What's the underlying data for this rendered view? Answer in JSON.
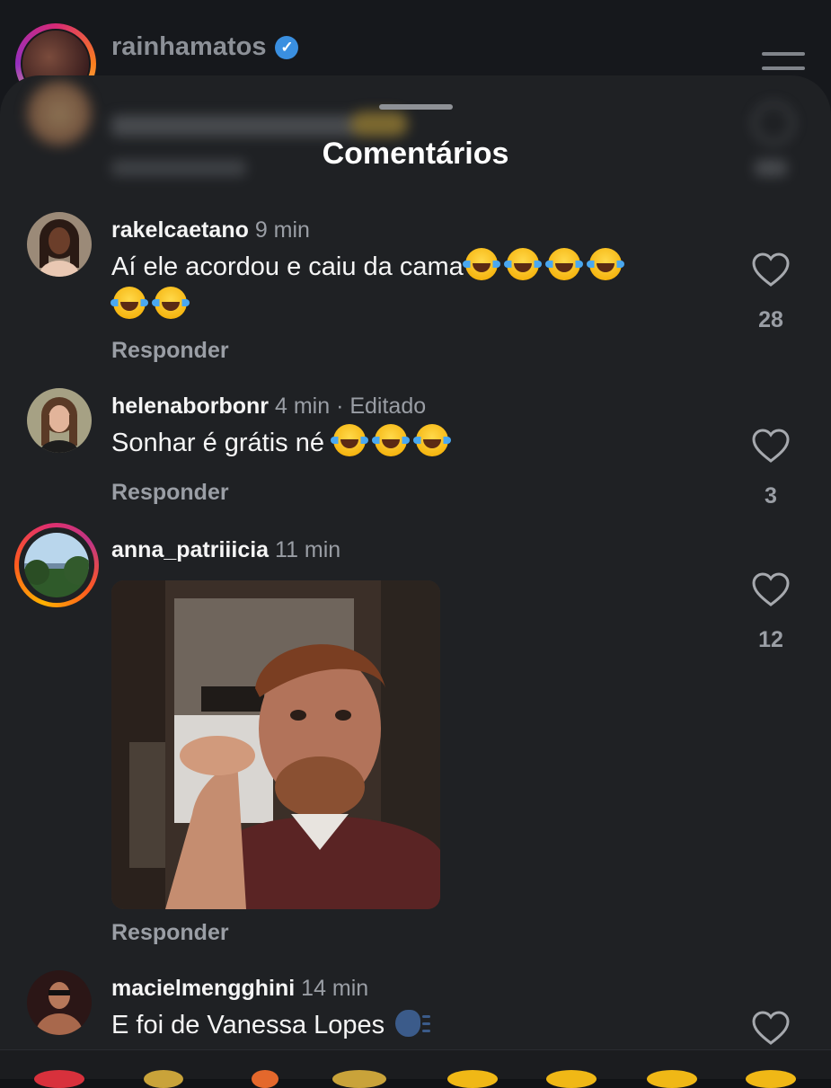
{
  "profile": {
    "username": "rainhamatos",
    "verified_icon": "verified-badge-icon",
    "menu_icon": "hamburger-menu-icon"
  },
  "sheet": {
    "title": "Comentários"
  },
  "comments": [
    {
      "username": "rakelcaetano",
      "time": "9 min",
      "edited": "",
      "text": "Aí ele acordou e caiu da cama",
      "emoji": "face-with-tears-of-joy",
      "emoji_count": 6,
      "reply_label": "Responder",
      "likes": "28"
    },
    {
      "username": "helenaborbonr",
      "time": "4 min",
      "edited": "· Editado",
      "text": "Sonhar é grátis né ",
      "emoji": "face-with-tears-of-joy",
      "emoji_count": 3,
      "reply_label": "Responder",
      "likes": "3"
    },
    {
      "username": "anna_patriiicia",
      "time": "11 min",
      "edited": "",
      "text": "",
      "media": "gif",
      "reply_label": "Responder",
      "likes": "12"
    },
    {
      "username": "macielmengghini",
      "time": "14 min",
      "edited": "",
      "text": "E foi de Vanessa Lopes ",
      "emoji": "speaking-head",
      "likes": ""
    }
  ],
  "icons": {
    "like": "heart-outline-icon"
  }
}
